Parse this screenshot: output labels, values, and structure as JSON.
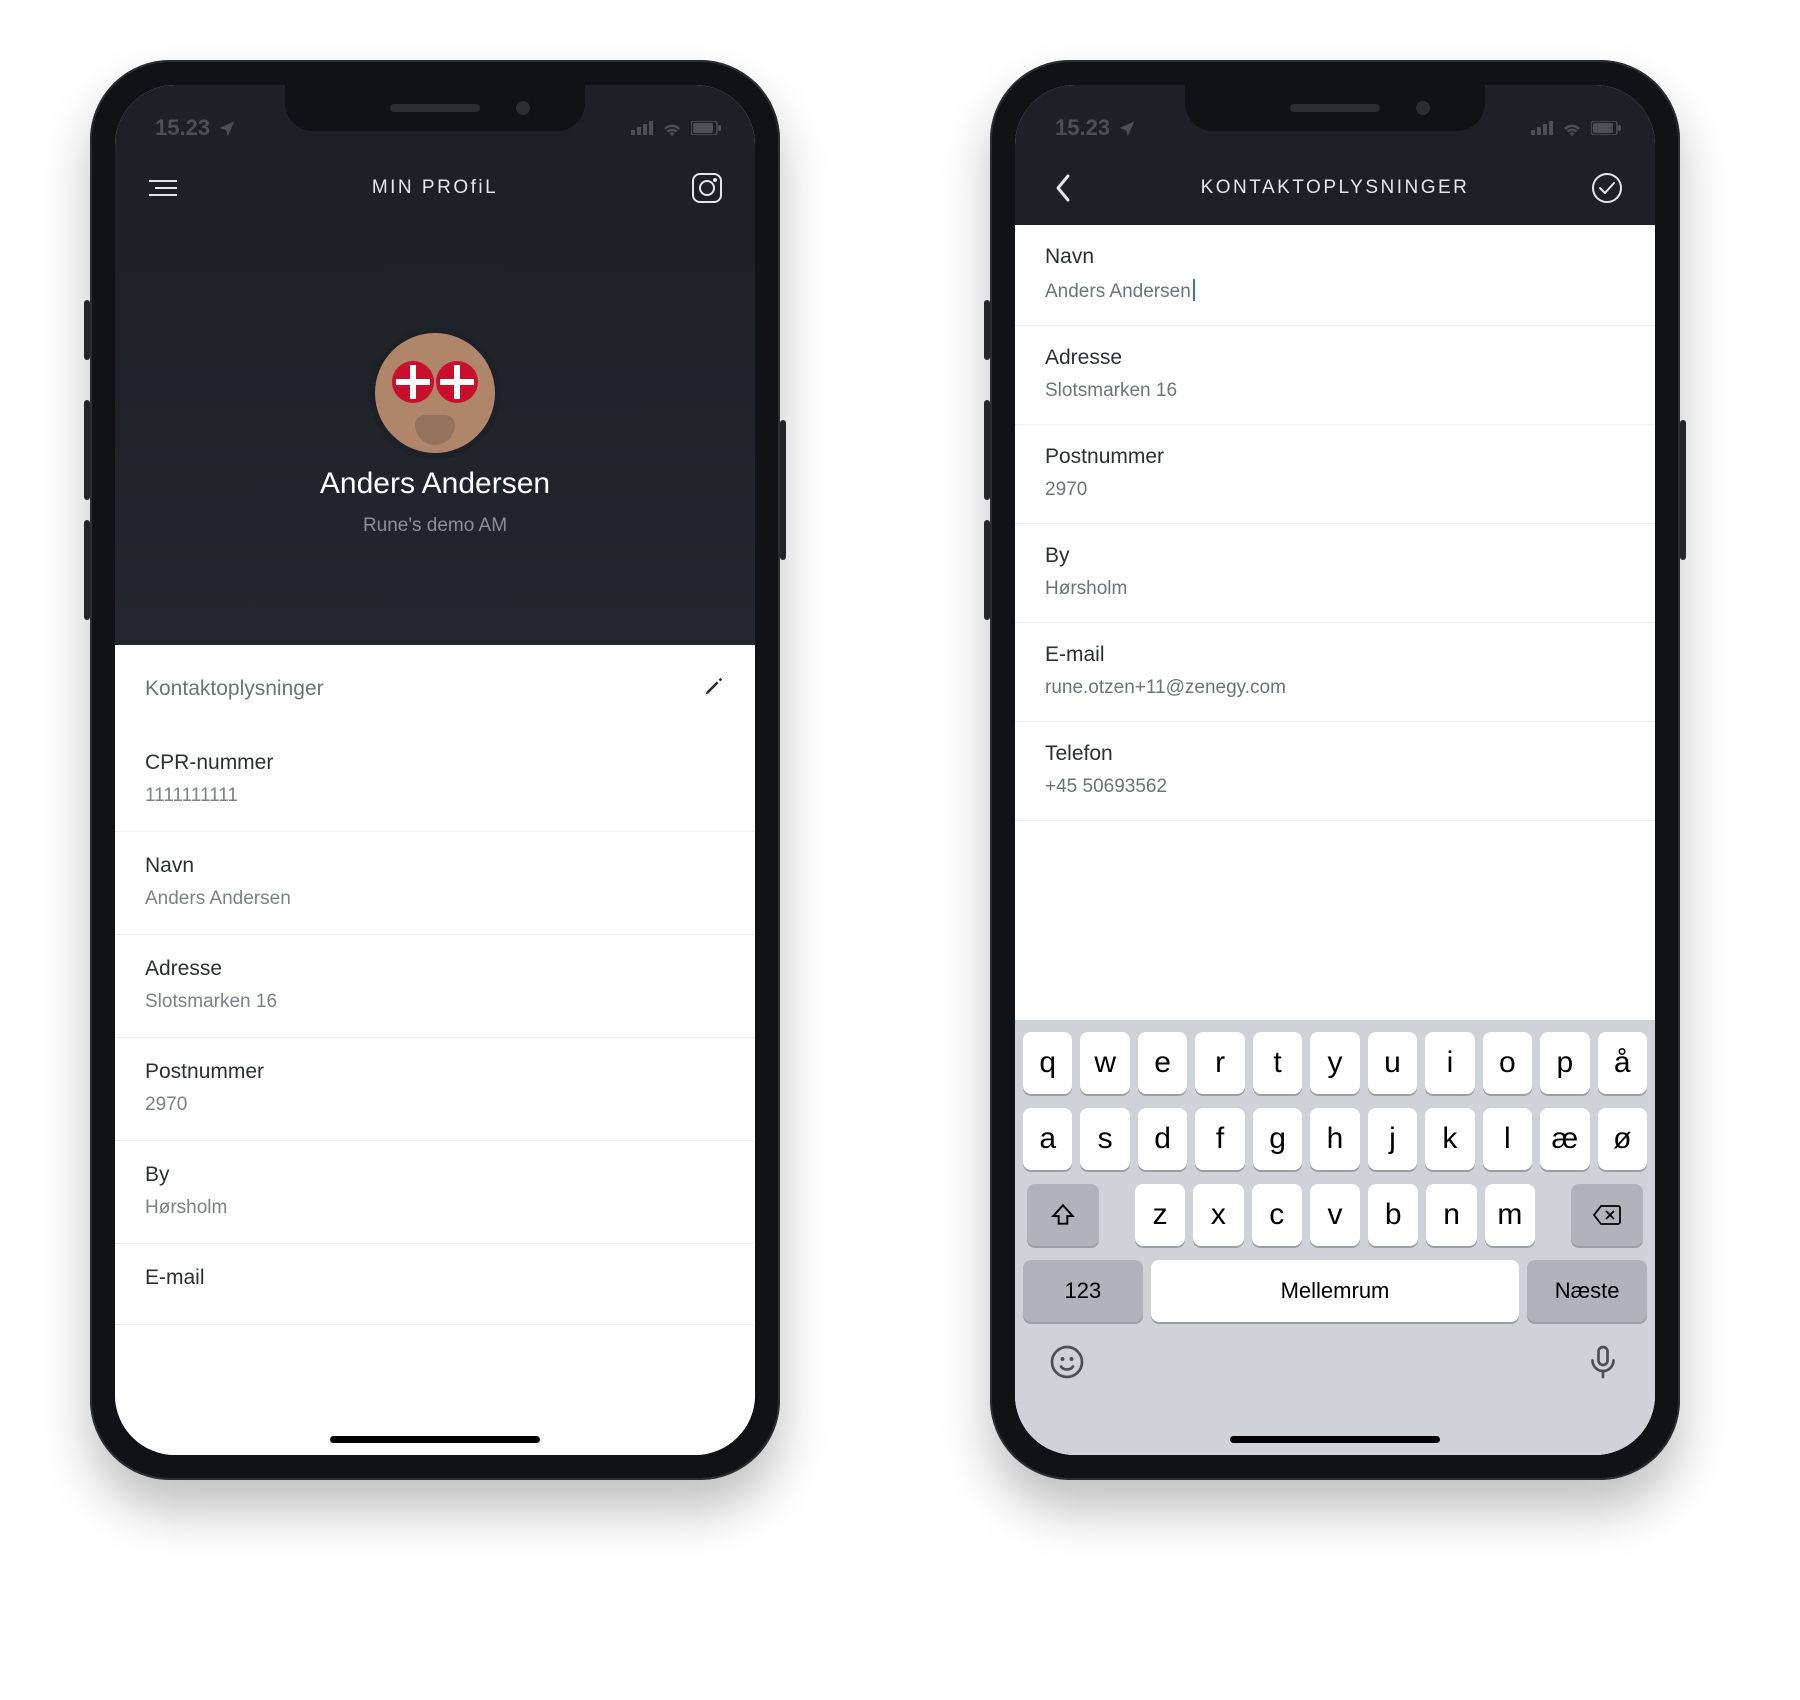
{
  "status": {
    "time": "15.23"
  },
  "left": {
    "title": "MIN PROfiL",
    "hero": {
      "name": "Anders Andersen",
      "subtitle": "Rune's demo AM"
    },
    "section": {
      "title": "Kontaktoplysninger",
      "rows": [
        {
          "label": "CPR-nummer",
          "value": "1111111111"
        },
        {
          "label": "Navn",
          "value": "Anders Andersen"
        },
        {
          "label": "Adresse",
          "value": "Slotsmarken 16"
        },
        {
          "label": "Postnummer",
          "value": "2970"
        },
        {
          "label": "By",
          "value": "Hørsholm"
        },
        {
          "label": "E-mail",
          "value": ""
        }
      ]
    }
  },
  "right": {
    "title": "KONTAKTOPLYSNINGER",
    "fields": [
      {
        "label": "Navn",
        "value": "Anders Andersen"
      },
      {
        "label": "Adresse",
        "value": "Slotsmarken 16"
      },
      {
        "label": "Postnummer",
        "value": "2970"
      },
      {
        "label": "By",
        "value": "Hørsholm"
      },
      {
        "label": "E-mail",
        "value": "rune.otzen+11@zenegy.com"
      },
      {
        "label": "Telefon",
        "value": "+45 50693562"
      }
    ]
  },
  "keyboard": {
    "row1": [
      "q",
      "w",
      "e",
      "r",
      "t",
      "y",
      "u",
      "i",
      "o",
      "p",
      "å"
    ],
    "row2": [
      "a",
      "s",
      "d",
      "f",
      "g",
      "h",
      "j",
      "k",
      "l",
      "æ",
      "ø"
    ],
    "row3": [
      "z",
      "x",
      "c",
      "v",
      "b",
      "n",
      "m"
    ],
    "numKey": "123",
    "space": "Mellemrum",
    "action": "Næste"
  }
}
